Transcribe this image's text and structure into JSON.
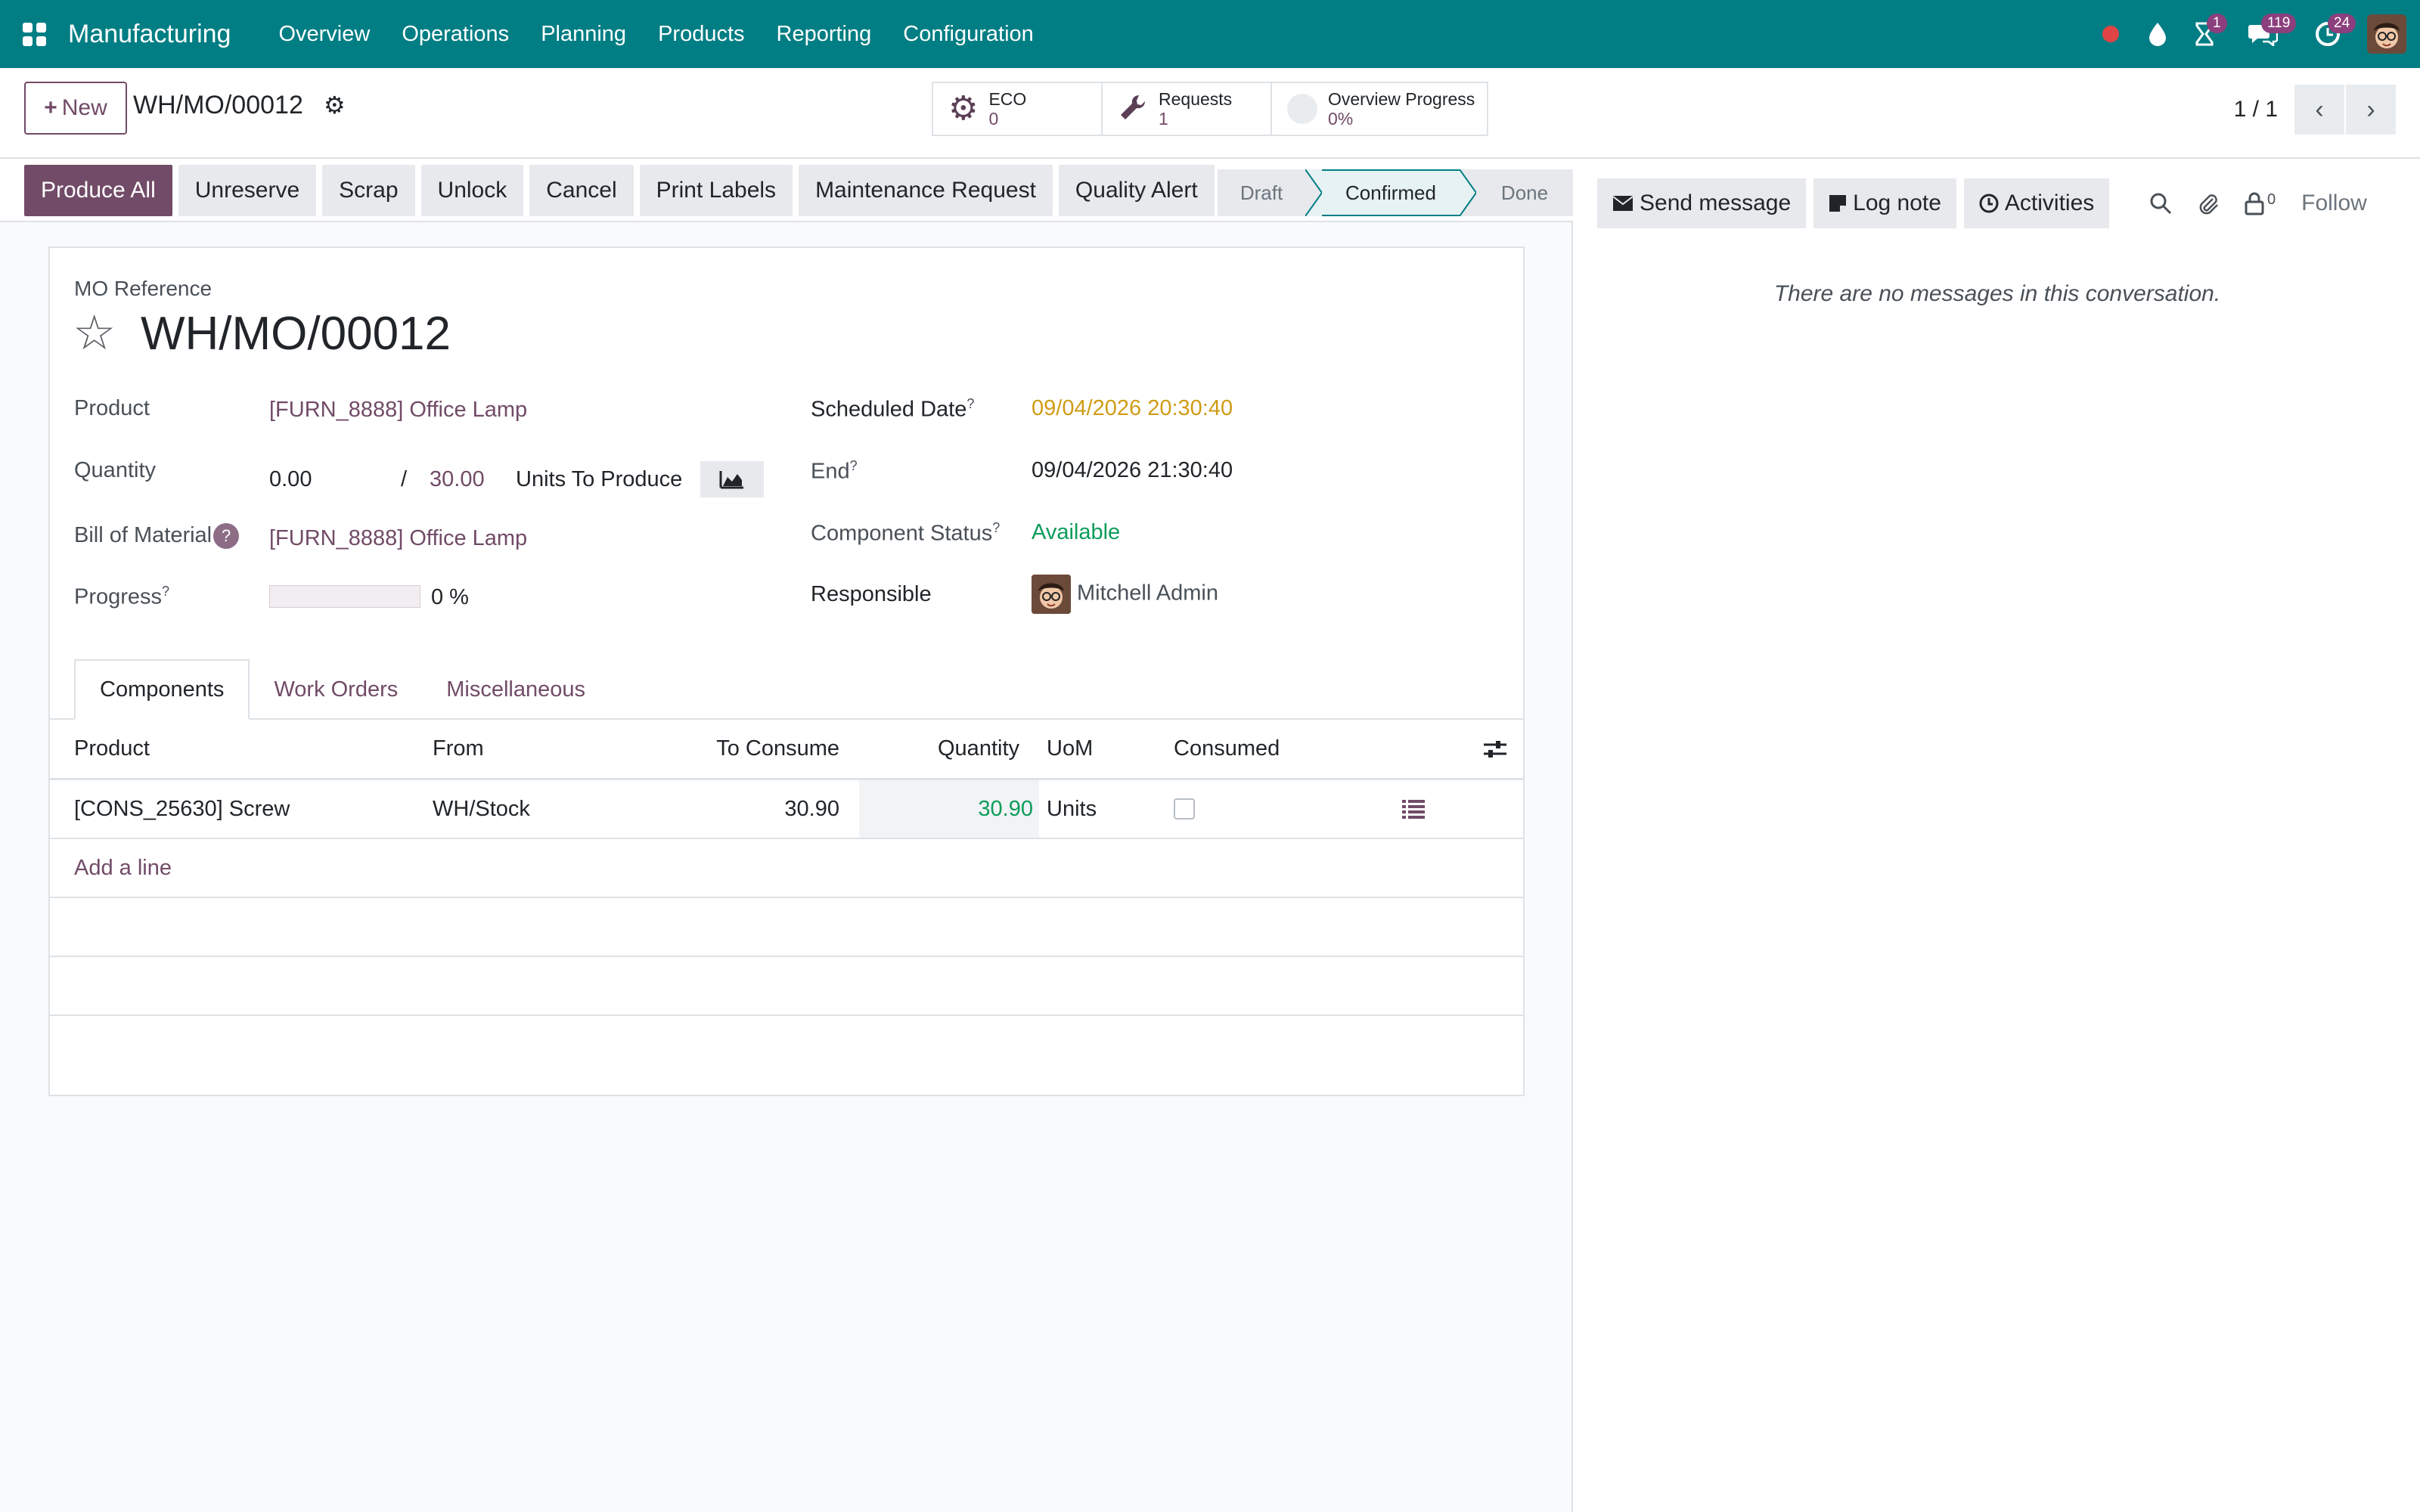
{
  "navbar": {
    "app_name": "Manufacturing",
    "menu": [
      "Overview",
      "Operations",
      "Planning",
      "Products",
      "Reporting",
      "Configuration"
    ],
    "badges": {
      "activities": "1",
      "messages": "119",
      "updates": "24"
    }
  },
  "control_panel": {
    "new_label": "New",
    "breadcrumb": "WH/MO/00012",
    "smart_buttons": {
      "eco": {
        "label": "ECO",
        "value": "0"
      },
      "requests": {
        "label": "Requests",
        "value": "1"
      },
      "overview": {
        "label": "Overview Progress",
        "value": "0%"
      }
    },
    "pager": "1 / 1"
  },
  "status_bar": {
    "actions": [
      "Produce All",
      "Unreserve",
      "Scrap",
      "Unlock",
      "Cancel",
      "Print Labels",
      "Maintenance Request",
      "Quality Alert"
    ],
    "stages": [
      "Draft",
      "Confirmed",
      "Done"
    ],
    "current_stage": "Confirmed"
  },
  "form": {
    "ref_label": "MO Reference",
    "title": "WH/MO/00012",
    "product_label": "Product",
    "product_value": "[FURN_8888] Office Lamp",
    "quantity_label": "Quantity",
    "qty_produced": "0.00",
    "qty_separator": "/",
    "qty_total": "30.00",
    "qty_units": "Units To Produce",
    "bom_label": "Bill of Material",
    "bom_help": "?",
    "bom_value": "[FURN_8888] Office Lamp",
    "progress_label": "Progress",
    "progress_value": "0 %",
    "progress_fraction": 0,
    "scheduled_label": "Scheduled Date",
    "scheduled_value": "09/04/2026 20:30:40",
    "end_label": "End",
    "end_value": "09/04/2026 21:30:40",
    "component_status_label": "Component Status",
    "component_status_value": "Available",
    "responsible_label": "Responsible",
    "responsible_value": "Mitchell Admin",
    "help_mark": "?"
  },
  "tabs": [
    "Components",
    "Work Orders",
    "Miscellaneous"
  ],
  "components": {
    "headers": {
      "product": "Product",
      "from": "From",
      "to_consume": "To Consume",
      "quantity": "Quantity",
      "uom": "UoM",
      "consumed": "Consumed"
    },
    "rows": [
      {
        "product": "[CONS_25630] Screw",
        "from": "WH/Stock",
        "to_consume": "30.90",
        "quantity": "30.90",
        "uom": "Units"
      }
    ],
    "add_line": "Add a line"
  },
  "chatter": {
    "send_message": "Send message",
    "log_note": "Log note",
    "activities": "Activities",
    "followers_count": "0",
    "follow": "Follow",
    "empty_text": "There are no messages in this conversation."
  },
  "colors": {
    "navbar": "#017e84",
    "primary": "#714b67",
    "warning": "#d09c16",
    "success": "#0c9c5a"
  }
}
